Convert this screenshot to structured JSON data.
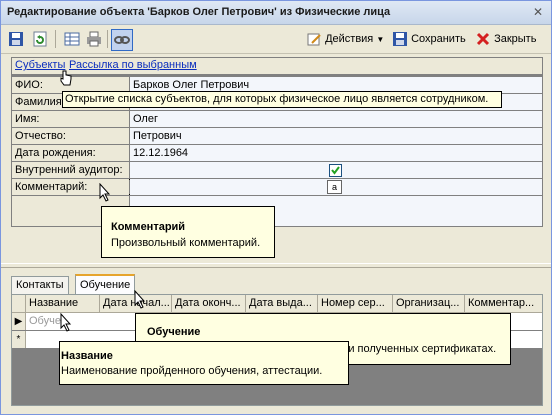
{
  "window": {
    "title": "Редактирование объекта 'Барков Олег Петрович' из Физические лица",
    "close_glyph": "✕"
  },
  "toolbar": {
    "actions_label": "Действия",
    "save_label": "Сохранить",
    "close_label": "Закрыть"
  },
  "links": {
    "subjects": "Субъекты",
    "mailing": "Рассылка по выбранным"
  },
  "tooltip_subjects": "Открытие списка субъектов, для которых физическое лицо является сотрудником.",
  "fields": {
    "fio": {
      "label": "ФИО:",
      "value": "Барков Олег Петрович"
    },
    "lastname": {
      "label": "Фамилия",
      "value": ""
    },
    "firstname": {
      "label": "Имя:",
      "value": "Олег"
    },
    "patronymic": {
      "label": "Отчество:",
      "value": "Петрович"
    },
    "birthdate": {
      "label": "Дата рождения:",
      "value": "12.12.1964"
    },
    "auditor": {
      "label": "Внутренний аудитор:",
      "checked": true
    },
    "comment": {
      "label": "Комментарий:",
      "icon_text": "a"
    }
  },
  "tooltip_comment": {
    "title": "Комментарий",
    "text": "Произвольный комментарий."
  },
  "tabs": [
    "Контакты",
    "Обучение"
  ],
  "grid": {
    "columns": [
      "Название",
      "Дата начал...",
      "Дата оконч...",
      "Дата выда...",
      "Номер сер...",
      "Организац...",
      "Комментар..."
    ],
    "new_row_placeholder": "Обуче...",
    "row_marker_current": "▶",
    "row_marker_new": "*"
  },
  "tooltip_training": {
    "title": "Обучение",
    "text": "Информация о пройденных обучениях и полученных сертификатах."
  },
  "tooltip_name": {
    "title": "Название",
    "text": "Наименование пройденного обучения, аттестации."
  }
}
